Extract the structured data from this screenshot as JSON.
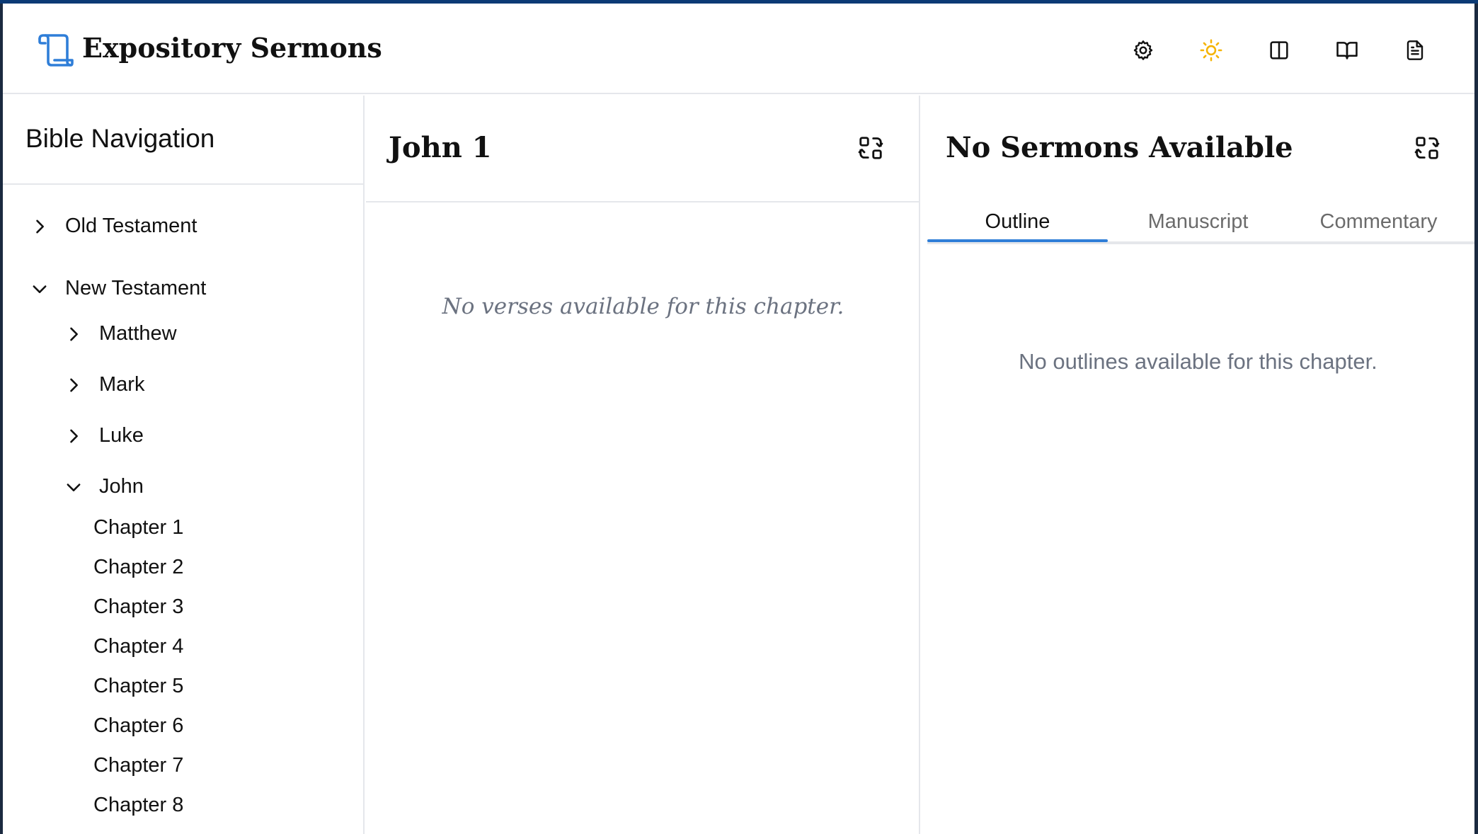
{
  "header": {
    "app_title": "Expository Sermons",
    "logo_icon": "scroll-icon",
    "brand_color": "#2f7ed8",
    "actions": [
      {
        "name": "settings-icon"
      },
      {
        "name": "sun-icon",
        "color": "#f5b301"
      },
      {
        "name": "columns-icon"
      },
      {
        "name": "open-book-icon"
      },
      {
        "name": "document-icon"
      }
    ]
  },
  "sidebar": {
    "title": "Bible Navigation",
    "testaments": [
      {
        "label": "Old Testament",
        "expanded": false
      },
      {
        "label": "New Testament",
        "expanded": true
      }
    ],
    "books": [
      {
        "label": "Matthew",
        "expanded": false
      },
      {
        "label": "Mark",
        "expanded": false
      },
      {
        "label": "Luke",
        "expanded": false
      },
      {
        "label": "John",
        "expanded": true
      }
    ],
    "chapters": [
      "Chapter 1",
      "Chapter 2",
      "Chapter 3",
      "Chapter 4",
      "Chapter 5",
      "Chapter 6",
      "Chapter 7",
      "Chapter 8"
    ]
  },
  "scripture": {
    "title": "John 1",
    "empty_message": "No verses available for this chapter."
  },
  "sermon": {
    "title": "No Sermons Available",
    "tabs": [
      "Outline",
      "Manuscript",
      "Commentary"
    ],
    "active_tab": "Outline",
    "empty_message": "No outlines available for this chapter."
  }
}
